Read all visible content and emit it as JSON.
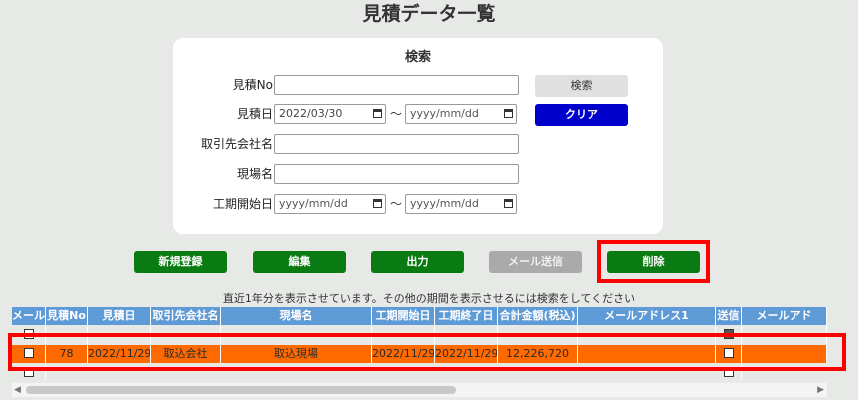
{
  "page": {
    "title": "見積データ一覧"
  },
  "search": {
    "title": "検索",
    "estimate_no_label": "見積No",
    "estimate_no_value": "",
    "estimate_date_label": "見積日",
    "estimate_date_from": "2022/03/30",
    "estimate_date_to": "yyyy/mm/dd",
    "tilde": "〜",
    "customer_label": "取引先会社名",
    "customer_value": "",
    "site_label": "現場名",
    "site_value": "",
    "start_date_label": "工期開始日",
    "start_date_from": "yyyy/mm/dd",
    "start_date_to": "yyyy/mm/dd",
    "search_button": "検索",
    "clear_button": "クリア"
  },
  "actions": {
    "new": "新規登録",
    "edit": "編集",
    "output": "出力",
    "send_mail": "メール送信",
    "delete": "削除"
  },
  "note": "直近1年分を表示させています。その他の期間を表示させるには検索をしてください",
  "table": {
    "headers": [
      "メール",
      "見積No",
      "見積日",
      "取引先会社名",
      "現場名",
      "工期開始日",
      "工期終了日",
      "合計金額(税込)",
      "メールアドレス1",
      "送信",
      "メールアド"
    ],
    "rows": [
      {
        "mail": false,
        "no": "78",
        "date": "2022/11/29",
        "customer": "取込会社",
        "site": "取込現場",
        "start": "2022/11/29",
        "end": "2022/11/29",
        "total": "12,226,720",
        "email": "",
        "sent": false,
        "email2": ""
      }
    ]
  },
  "colors": {
    "accent_green": "#0a7a12",
    "clear_blue": "#0000cc",
    "header_blue": "#5e9ad6",
    "selected_row": "#ff6a00",
    "highlight": "#ff0000"
  }
}
